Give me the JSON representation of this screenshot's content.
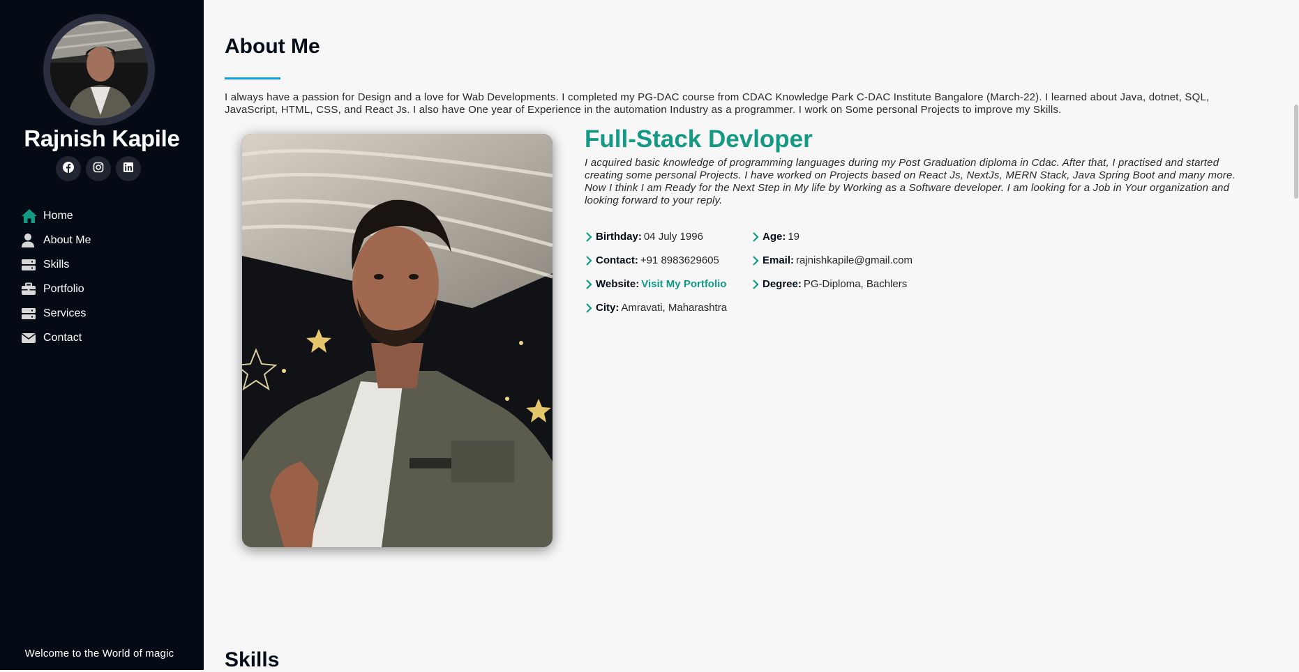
{
  "sidebar": {
    "name": "Rajnish Kapile",
    "social": [
      {
        "icon": "facebook-icon"
      },
      {
        "icon": "instagram-icon"
      },
      {
        "icon": "linkedin-icon"
      }
    ],
    "nav": [
      {
        "label": "Home",
        "icon": "home-icon",
        "active": true
      },
      {
        "label": "About Me",
        "icon": "user-icon"
      },
      {
        "label": "Skills",
        "icon": "server-icon"
      },
      {
        "label": "Portfolio",
        "icon": "briefcase-icon"
      },
      {
        "label": "Services",
        "icon": "server-icon"
      },
      {
        "label": "Contact",
        "icon": "envelope-icon"
      }
    ],
    "footer": "Welcome to the World of magic"
  },
  "about": {
    "title": "About Me",
    "intro": "I always have a passion for Design and a love for Wab Developments. I completed my PG-DAC course from CDAC Knowledge Park C-DAC Institute Bangalore (March-22). I learned about Java, dotnet, SQL, JavaScript, HTML, CSS, and React Js. I also have One year of Experience in the automation Industry as a programmer. I work on Some personal Projects to improve my Skills.",
    "role": "Full-Stack Devloper",
    "role_desc": "I acquired basic knowledge of programming languages during my Post Graduation diploma in Cdac. After that, I practised and started creating some personal Projects. I have worked on Projects based on React Js, NextJs, MERN Stack, Java Spring Boot and many more. Now I think I am Ready for the Next Step in My life by Working as a Software developer. I am looking for a Job in Your organization and looking forward to your reply.",
    "info": {
      "birthday": {
        "label": "Birthday:",
        "value": "04 July 1996"
      },
      "age": {
        "label": "Age:",
        "value": "19"
      },
      "contact": {
        "label": "Contact:",
        "value": "+91 8983629605"
      },
      "email": {
        "label": "Email:",
        "value": "rajnishkapile@gmail.com"
      },
      "website": {
        "label": "Website:",
        "value": "Visit My Portfolio"
      },
      "degree": {
        "label": "Degree:",
        "value": "PG-Diploma, Bachlers"
      },
      "city": {
        "label": "City:",
        "value": "Amravati, Maharashtra"
      }
    }
  },
  "skills": {
    "title": "Skills"
  },
  "colors": {
    "sidebar_bg": "#040b14",
    "accent": "#149a84",
    "underline": "#149ddd",
    "page_bg": "#f7f7f7"
  }
}
